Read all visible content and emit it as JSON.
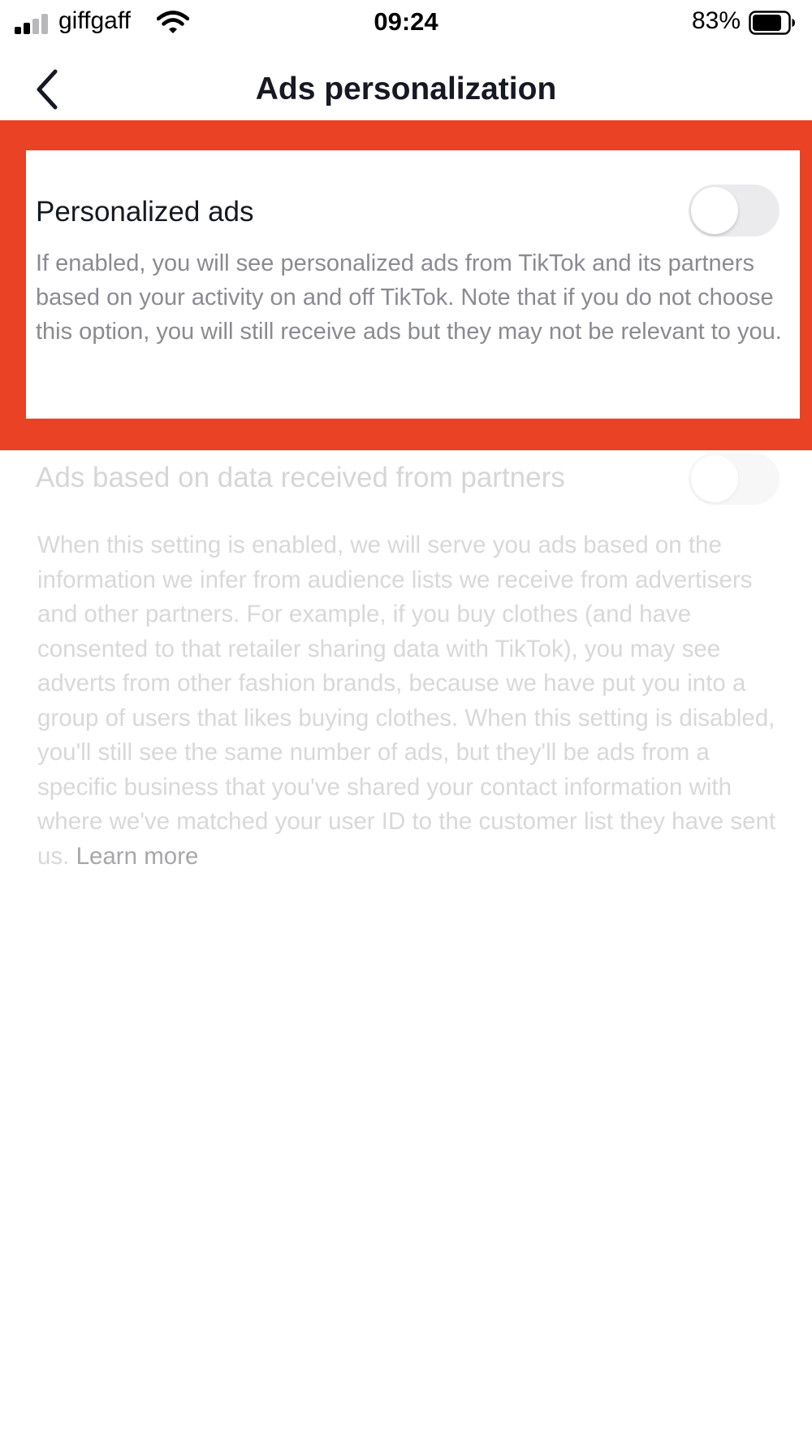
{
  "status_bar": {
    "carrier": "giffgaff",
    "time": "09:24",
    "battery_percent": "83%",
    "battery_level": 0.83,
    "signal_bars_active": 2,
    "signal_bars_total": 4
  },
  "header": {
    "title": "Ads personalization",
    "back_icon": "chevron-left-icon"
  },
  "settings": [
    {
      "title": "Personalized ads",
      "description": "If enabled, you will see personalized ads from TikTok and its partners based on your activity on and off TikTok.  Note that if you do not choose this option, you will still receive ads but they may not be relevant to you.",
      "enabled": false,
      "disabled": false,
      "highlighted": true
    },
    {
      "title": "Ads based on data received from partners",
      "description": "When this setting is enabled, we will serve you ads based on the information we infer from audience lists we receive from advertisers and other partners. For example, if you buy clothes (and have consented to that retailer sharing data with TikTok), you may see adverts from other fashion brands, because we have put you into a group of users that likes buying clothes. When this setting is disabled, you'll still see the same number of ads, but they'll be ads from a specific business that you've shared your contact information with where we've matched your user ID to the customer list they have sent us. ",
      "link_label": "Learn more",
      "enabled": false,
      "disabled": true
    }
  ],
  "colors": {
    "highlight": "#ea4224",
    "title_text": "#161823",
    "description_text": "#8a8b91",
    "disabled_text": "#d8d8da",
    "toggle_off": "#ebebed"
  }
}
